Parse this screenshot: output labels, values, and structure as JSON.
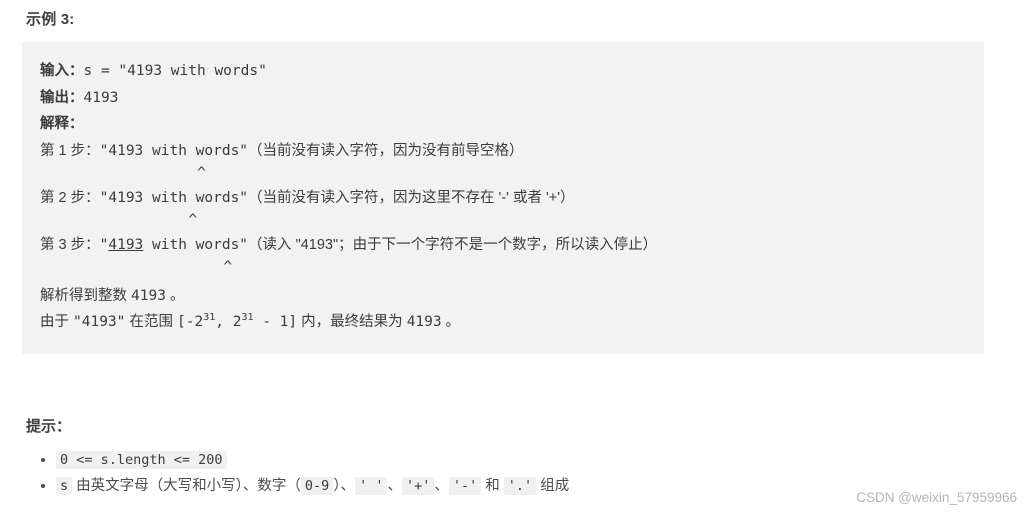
{
  "section": {
    "title": "示例 3:"
  },
  "example": {
    "input_label": "输入：",
    "input_value": "s = \"4193 with words\"",
    "output_label": "输出：",
    "output_value": "4193",
    "explain_label": "解释：",
    "steps": [
      {
        "prefix": "第 1 步：",
        "code": "\"4193 with words\"",
        "note": "（当前没有读入字符，因为没有前导空格）",
        "caret": "^",
        "caret_indent": 9,
        "underline_from": -1,
        "underline_to": -1
      },
      {
        "prefix": "第 2 步：",
        "code": "\"4193 with words\"",
        "note": "（当前没有读入字符，因为这里不存在 '-' 或者 '+'）",
        "caret": "^",
        "caret_indent": 8,
        "underline_from": -1,
        "underline_to": -1
      },
      {
        "prefix": "第 3 步：",
        "code_pre": "\"",
        "code_underlined": "4193",
        "code_post": " with words\"",
        "note": "（读入 \"4193\"；由于下一个字符不是一个数字，所以读入停止）",
        "caret": "^",
        "caret_indent": 12
      }
    ],
    "result_line1_a": "解析得到整数 ",
    "result_line1_b": "4193",
    "result_line1_c": " 。",
    "result_line2_a": "由于 ",
    "result_line2_b": "\"4193\"",
    "result_line2_c": " 在范围 ",
    "result_line2_d": "[-2",
    "result_line2_sup1": "31",
    "result_line2_e": ", 2",
    "result_line2_sup2": "31",
    "result_line2_f": " - 1]",
    "result_line2_g": " 内，最终结果为 ",
    "result_line2_h": "4193",
    "result_line2_i": " 。"
  },
  "hints": {
    "title": "提示：",
    "items": [
      {
        "code": "0 <= s.length <= 200",
        "text": ""
      }
    ],
    "item2": {
      "s": "s",
      "part1": " 由英文字母（大写和小写）、数字（",
      "code09": "0-9",
      "part2": "）、",
      "c1": "' '",
      "sep1": "、",
      "c2": "'+'",
      "sep2": "、",
      "c3": "'-'",
      "sep3": " 和 ",
      "c4": "'.'",
      "part3": " 组成"
    }
  },
  "watermark": "CSDN @weixin_57959966"
}
